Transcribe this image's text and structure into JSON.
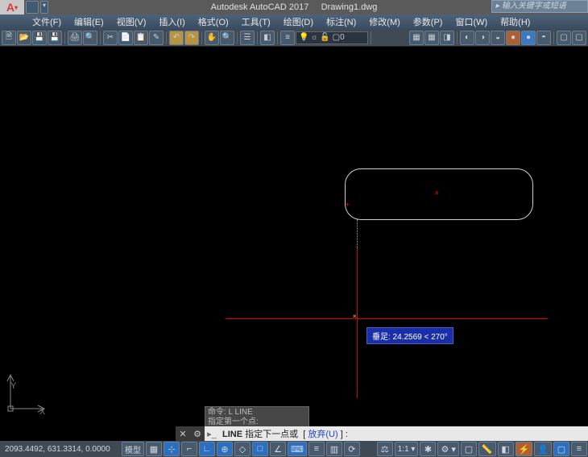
{
  "title": {
    "app": "Autodesk AutoCAD 2017",
    "doc": "Drawing1.dwg"
  },
  "search": {
    "placeholder": "输入关键字或短语"
  },
  "menu": [
    "文件(F)",
    "编辑(E)",
    "视图(V)",
    "插入(I)",
    "格式(O)",
    "工具(T)",
    "绘图(D)",
    "标注(N)",
    "修改(M)",
    "参数(P)",
    "窗口(W)",
    "帮助(H)"
  ],
  "layer": {
    "current": "0"
  },
  "tooltip": {
    "text": "垂足: 24.2569 < 270°"
  },
  "cmd_history": {
    "l1": "命令: L LINE",
    "l2": "指定第一个点:"
  },
  "cmdline": {
    "cmd": "LINE",
    "prompt": "指定下一点或",
    "opt": "放弃(U)",
    "tail": "] :"
  },
  "status": {
    "coords": "2093.4492, 631.3314, 0.0000",
    "space": "模型"
  },
  "ucs": {
    "x": "X",
    "y": "Y"
  }
}
